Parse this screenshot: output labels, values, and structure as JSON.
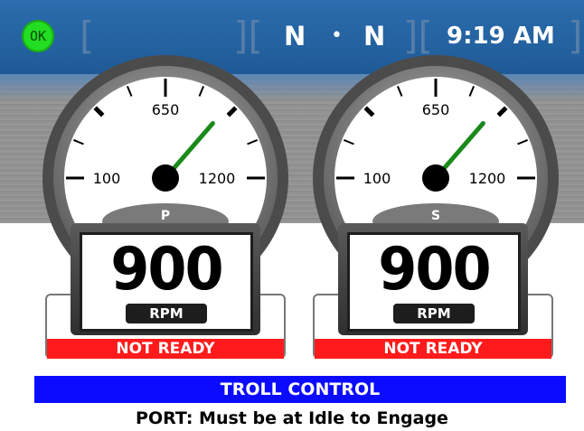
{
  "status_bar": {
    "ok_indicator": "OK",
    "ok_color": "#22dd22",
    "port_gear": "N",
    "starboard_gear": "N",
    "separator": "•",
    "time": "9:19 AM"
  },
  "gauges": [
    {
      "id": "port",
      "side_label": "P",
      "scale_min": "100",
      "scale_mid": "650",
      "scale_max": "1200",
      "rpm": "900",
      "rpm_unit": "RPM",
      "status": "NOT READY",
      "needle_rpm": 900
    },
    {
      "id": "starboard",
      "side_label": "S",
      "scale_min": "100",
      "scale_mid": "650",
      "scale_max": "1200",
      "rpm": "900",
      "rpm_unit": "RPM",
      "status": "NOT READY",
      "needle_rpm": 900
    }
  ],
  "troll": {
    "title": "TROLL CONTROL",
    "message": "PORT: Must be at Idle to Engage"
  },
  "colors": {
    "topbar": "#2b6dad",
    "status_not_ready": "#ff1b1b",
    "troll_bar": "#0b0bff",
    "needle": "#1a8a1a"
  }
}
